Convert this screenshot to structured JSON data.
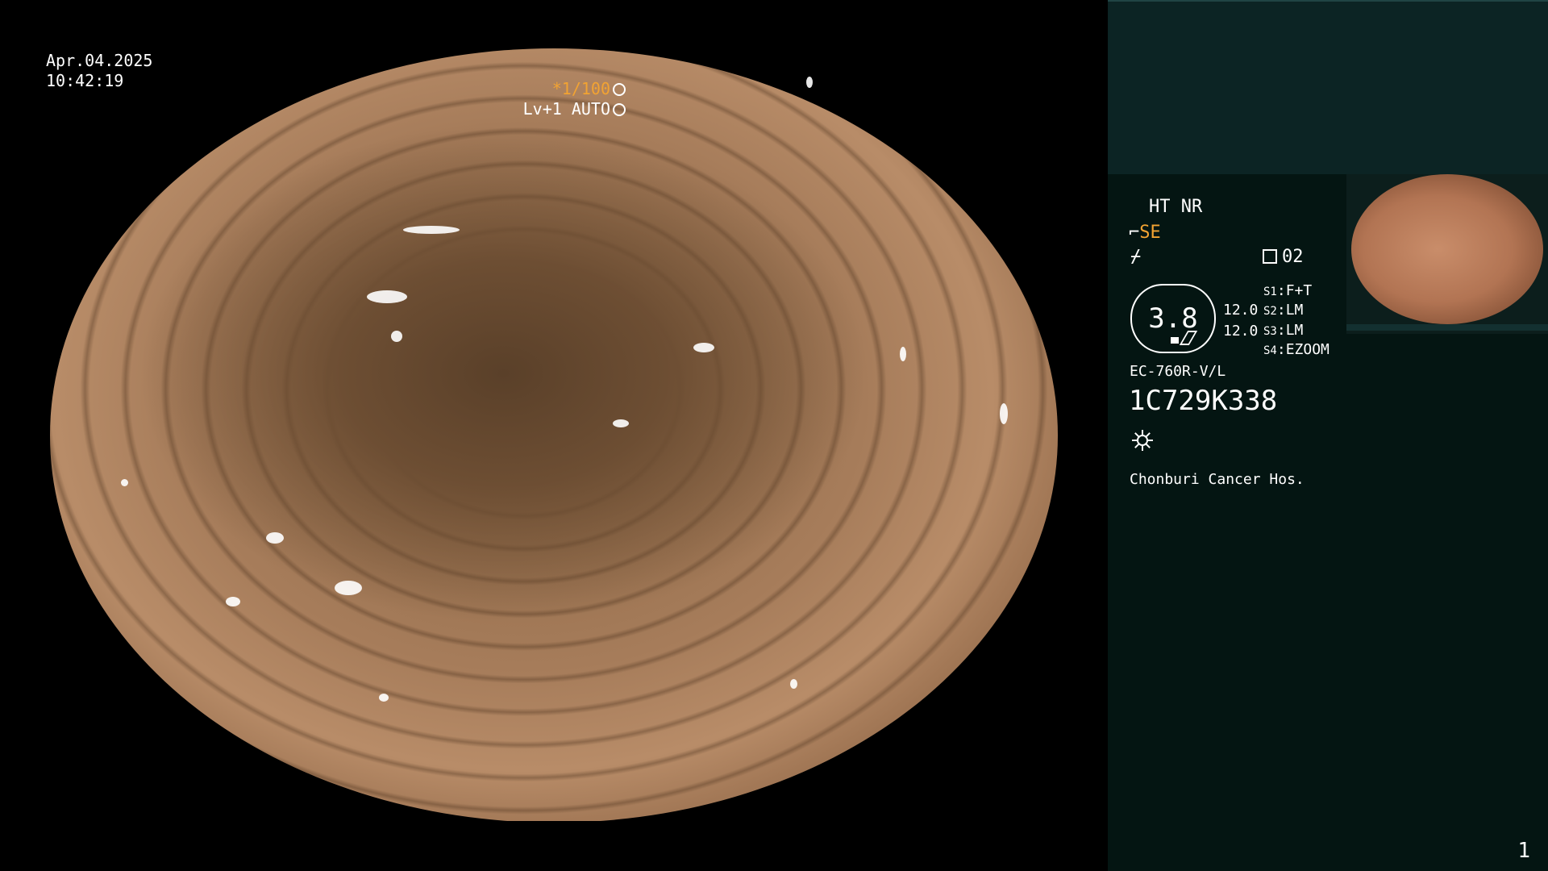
{
  "endoscopy_view": {
    "date": "Apr.04.2025",
    "time": "10:42:19"
  },
  "shutter": {
    "value": "*1/100",
    "shutter_icon": "aperture-icon",
    "level": "Lv+1 AUTO",
    "auto_icon": "auto-iris-icon"
  },
  "panel": {
    "enhance": "HT NR",
    "se_icon": "scope-mode-icon",
    "se_label": "SE",
    "freeze_icon": "freeze-icon",
    "memo_icon": "memo-icon",
    "memo_value": "02",
    "magnification": "3.8",
    "values": [
      "12.0",
      "12.0"
    ],
    "switches": [
      {
        "key": "S1",
        "value": "F+T"
      },
      {
        "key": "S2",
        "value": "LM"
      },
      {
        "key": "S3",
        "value": "LM"
      },
      {
        "key": "S4",
        "value": "EZOOM"
      }
    ],
    "scope_model": "EC-760R-V/L",
    "serial": "1C729K338",
    "light_icon": "light-sun-icon",
    "hospital": "Chonburi Cancer Hos."
  },
  "page_number": "1",
  "colors": {
    "panel_bg": "#041512",
    "panel_top_bg": "#0c2424",
    "accent_orange": "#f2a332"
  }
}
